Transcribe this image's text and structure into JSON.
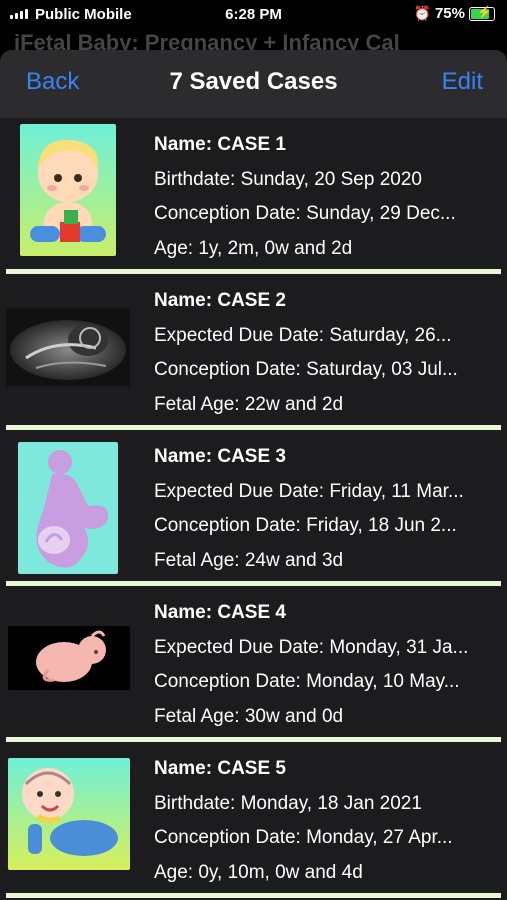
{
  "status_bar": {
    "carrier": "Public Mobile",
    "time": "6:28 PM",
    "battery_percent": "75%",
    "battery_level": 0.75
  },
  "background_title": "iFetal Baby: Pregnancy + Infancy Cal",
  "nav": {
    "back_label": "Back",
    "title": "7 Saved Cases",
    "edit_label": "Edit",
    "accent_color": "#3a82f7"
  },
  "cases": [
    {
      "image": "toddler-with-blocks",
      "name": "Name: CASE 1",
      "line2": "Birthdate: Sunday, 20 Sep 2020",
      "line3": "Conception Date: Sunday, 29 Dec...",
      "line4": "Age: 1y, 2m, 0w and 2d"
    },
    {
      "image": "ultrasound-scan",
      "name": "Name: CASE 2",
      "line2": "Expected Due Date: Saturday, 26...",
      "line3": "Conception Date: Saturday, 03 Jul...",
      "line4": "Fetal Age: 22w and 2d"
    },
    {
      "image": "pregnant-silhouette",
      "name": "Name: CASE 3",
      "line2": "Expected Due Date: Friday, 11 Mar...",
      "line3": "Conception Date: Friday, 18 Jun 2...",
      "line4": "Fetal Age: 24w and 3d"
    },
    {
      "image": "fetus-illustration",
      "name": "Name: CASE 4",
      "line2": "Expected Due Date: Monday, 31 Ja...",
      "line3": "Conception Date: Monday, 10 May...",
      "line4": "Fetal Age: 30w and 0d"
    },
    {
      "image": "crawling-baby",
      "name": "Name: CASE 5",
      "line2": "Birthdate: Monday, 18 Jan 2021",
      "line3": "Conception Date: Monday, 27 Apr...",
      "line4": "Age: 0y, 10m, 0w and 4d"
    }
  ]
}
